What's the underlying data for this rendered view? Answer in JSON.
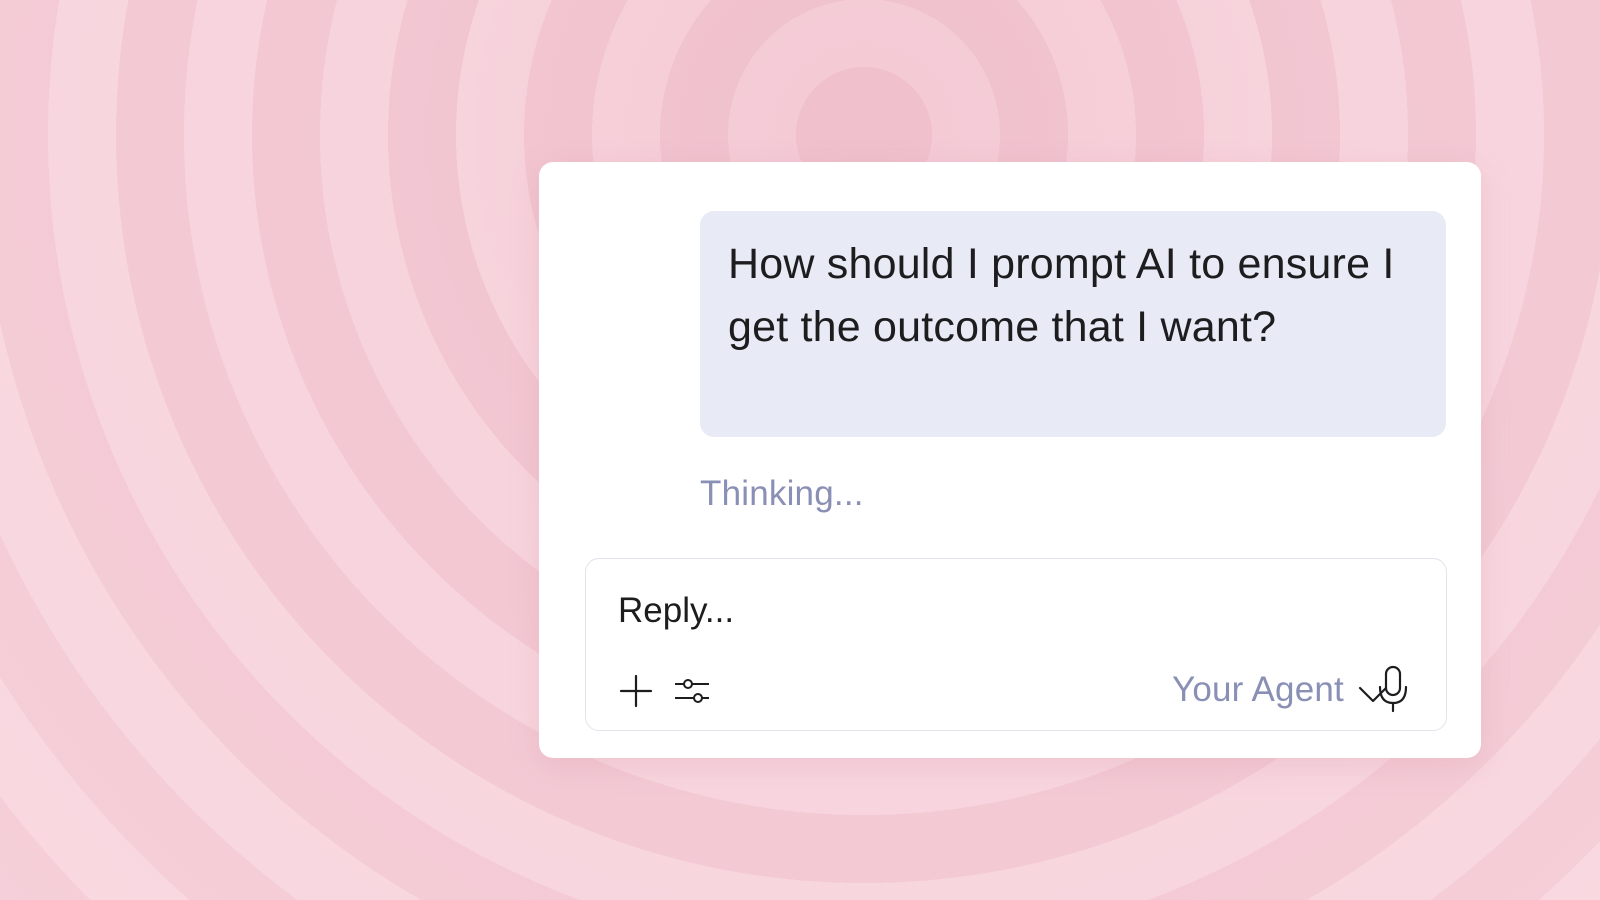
{
  "conversation": {
    "user_message": "How should I prompt AI to ensure I get the outcome that I want?",
    "status_text": "Thinking..."
  },
  "composer": {
    "placeholder": "Reply...",
    "agent_label": "Your Agent"
  },
  "icons": {
    "add": "plus-icon",
    "settings": "sliders-icon",
    "agent_dropdown": "chevron-down-icon",
    "mic": "microphone-icon"
  },
  "colors": {
    "background_rings": [
      "#f2c6d1",
      "#f7d3dc"
    ],
    "card": "#ffffff",
    "user_bubble": "#e8ebf6",
    "muted_text": "#8a8fb5",
    "text": "#1d1d1f"
  }
}
